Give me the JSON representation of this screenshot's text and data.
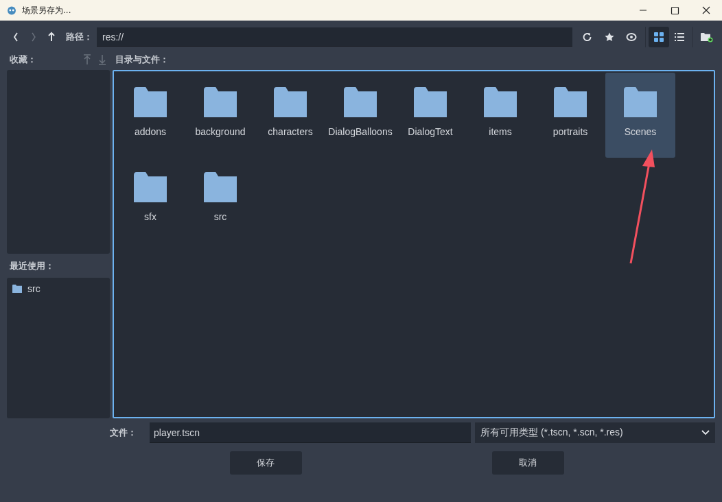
{
  "window": {
    "title": "场景另存为..."
  },
  "toolbar": {
    "nav": [
      {
        "kind": "back",
        "disabled": false
      },
      {
        "kind": "forward",
        "disabled": true
      },
      {
        "kind": "up",
        "disabled": false
      }
    ],
    "path_label": "路径：",
    "path": "res://",
    "view_modes": [
      {
        "kind": "grid",
        "selected": true
      },
      {
        "kind": "list",
        "selected": false
      }
    ]
  },
  "favorites": {
    "label": "收藏：",
    "move_up_disabled": true,
    "move_down_disabled": true
  },
  "recent": {
    "label": "最近使用：",
    "items": [
      "src"
    ]
  },
  "files": {
    "label": "目录与文件：",
    "folders": [
      {
        "name": "addons",
        "selected": false
      },
      {
        "name": "background",
        "selected": false
      },
      {
        "name": "characters",
        "selected": false
      },
      {
        "name": "DialogBalloons",
        "selected": false
      },
      {
        "name": "DialogText",
        "selected": false
      },
      {
        "name": "items",
        "selected": false
      },
      {
        "name": "portraits",
        "selected": false
      },
      {
        "name": "Scenes",
        "selected": true
      },
      {
        "name": "sfx",
        "selected": false
      },
      {
        "name": "src",
        "selected": false
      }
    ]
  },
  "annotation": {
    "kind": "arrow"
  },
  "file_row": {
    "label": "文件：",
    "filename": "player.tscn",
    "filter": "所有可用类型 (*.tscn, *.scn, *.res)"
  },
  "buttons": [
    "保存",
    "取消"
  ]
}
